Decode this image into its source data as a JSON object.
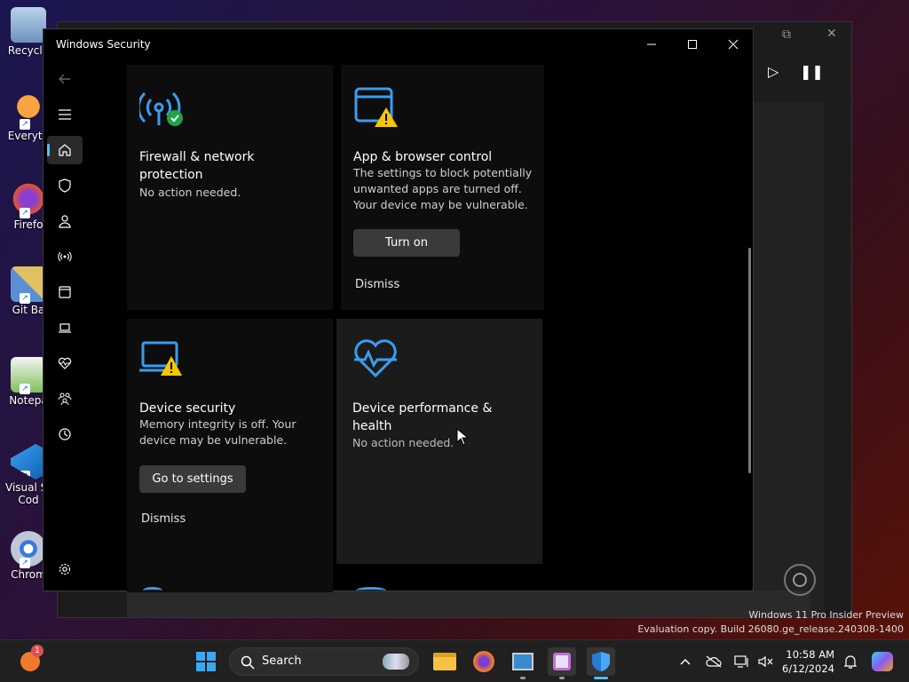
{
  "desktop": {
    "icons": [
      {
        "label": "Recycle",
        "icon": "recycle-bin-icon",
        "color": "#8fb4d8"
      },
      {
        "label": "Everyth",
        "icon": "everything-search-icon",
        "color": "#f08a1c"
      },
      {
        "label": "Firefo",
        "icon": "firefox-icon",
        "color": "#e8542a"
      },
      {
        "label": "Git Ba",
        "icon": "git-bash-icon",
        "color": "#5a8fd8"
      },
      {
        "label": "Notepa",
        "icon": "notepad-icon",
        "color": "#6fb84a"
      },
      {
        "label": "Visual St",
        "label2": "Cod",
        "icon": "vscode-icon",
        "color": "#1f8ad6"
      },
      {
        "label": "Chrom",
        "icon": "chrome-icon",
        "color": "#3a78e0"
      }
    ]
  },
  "window": {
    "title": "Windows Security"
  },
  "nav": {
    "items": [
      "home-icon",
      "shield-icon",
      "account-icon",
      "firewall-icon",
      "app-browser-icon",
      "device-security-icon",
      "heart-icon",
      "family-icon",
      "history-icon"
    ],
    "settings": "settings-gear-icon"
  },
  "cards": {
    "firewall": {
      "title1": "Firewall & network",
      "title2": "protection",
      "desc": "No action needed."
    },
    "app_browser": {
      "title": "App & browser control",
      "desc1": "The settings to block potentially",
      "desc2": "unwanted apps are turned off.",
      "desc3": "Your device may be vulnerable.",
      "button": "Turn on",
      "dismiss": "Dismiss"
    },
    "device_security": {
      "title": "Device security",
      "desc1": "Memory integrity is off. Your",
      "desc2": "device may be vulnerable.",
      "button": "Go to settings",
      "dismiss": "Dismiss"
    },
    "performance": {
      "title1": "Device performance &",
      "title2": "health",
      "desc": "No action needed."
    }
  },
  "watermark": {
    "line1": "Windows 11 Pro Insider Preview",
    "line2": "Evaluation copy. Build 26080.ge_release.240308-1400"
  },
  "taskbar": {
    "search_label": "Search",
    "time": "10:58 AM",
    "date": "6/12/2024",
    "notification_count": "1",
    "accent": "#4cc2ff"
  }
}
